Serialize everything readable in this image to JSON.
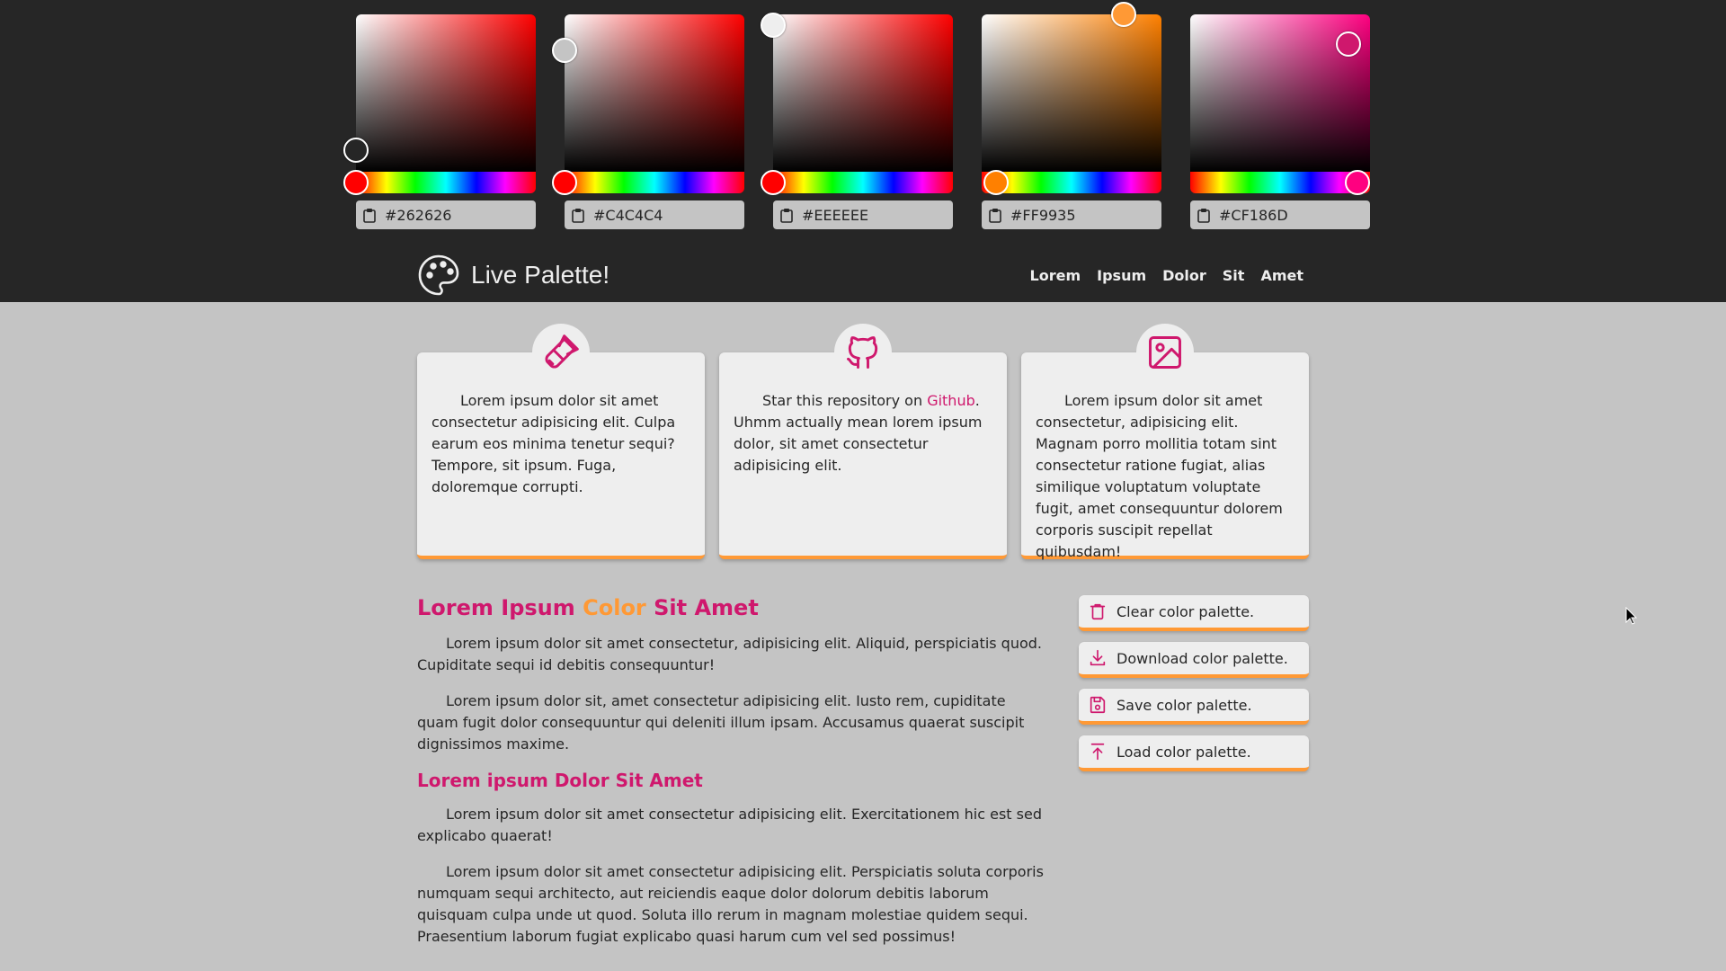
{
  "colors": {
    "dark": "#262626",
    "mid": "#c4c4c4",
    "light": "#eeeeee",
    "orange": "#ff9935",
    "pink": "#cf186d"
  },
  "pickers": [
    {
      "hex": "#262626",
      "hue_color": "#ff0000",
      "sv": [
        0.0,
        0.86
      ],
      "hue": 0.0
    },
    {
      "hex": "#C4C4C4",
      "hue_color": "#ff0000",
      "sv": [
        0.0,
        0.23
      ],
      "hue": 0.0
    },
    {
      "hex": "#EEEEEE",
      "hue_color": "#ff0000",
      "sv": [
        0.0,
        0.07
      ],
      "hue": 0.0
    },
    {
      "hex": "#FF9935",
      "hue_color": "#ff8000",
      "sv": [
        0.79,
        0.0
      ],
      "hue": 0.08
    },
    {
      "hex": "#CF186D",
      "hue_color": "#ff0080",
      "sv": [
        0.88,
        0.19
      ],
      "hue": 0.93
    }
  ],
  "header": {
    "title": "Live Palette!",
    "logo_icon": "palette-icon",
    "nav": [
      "Lorem",
      "Ipsum",
      "Dolor",
      "Sit",
      "Amet"
    ]
  },
  "cards": [
    {
      "icon": "paintbrush-icon",
      "text": "Lorem ipsum dolor sit amet consectetur adipisicing elit. Culpa earum eos minima tenetur sequi? Tempore, sit ipsum. Fuga, doloremque corrupti."
    },
    {
      "icon": "github-icon",
      "text_before": "Star this repository on ",
      "link": "Github",
      "text_after": ". Uhmm actually mean lorem ipsum dolor, sit amet consectetur adipisicing elit."
    },
    {
      "icon": "image-icon",
      "text": "Lorem ipsum dolor sit amet consectetur, adipisicing elit. Magnam porro mollitia totam sint consectetur ratione fugiat, alias similique voluptatum voluptate fugit, amet consequuntur dolorem corporis suscipit repellat quibusdam!"
    }
  ],
  "content": {
    "heading_part1": "Lorem Ipsum ",
    "heading_accent": "Color",
    "heading_part2": " Sit Amet",
    "paragraphs1": [
      "Lorem ipsum dolor sit amet consectetur, adipisicing elit. Aliquid, perspiciatis quod. Cupiditate sequi id debitis consequuntur!",
      "Lorem ipsum dolor sit, amet consectetur adipisicing elit. Iusto rem, cupiditate quam fugit dolor consequuntur qui deleniti illum ipsam. Accusamus quaerat suscipit dignissimos maxime."
    ],
    "subheading": "Lorem ipsum Dolor Sit Amet",
    "paragraphs2": [
      "Lorem ipsum dolor sit amet consectetur adipisicing elit. Exercitationem hic est sed explicabo quaerat!",
      "Lorem ipsum dolor sit amet consectetur adipisicing elit. Perspiciatis soluta corporis numquam sequi architecto, aut reiciendis eaque dolor dolorum debitis laborum quisquam culpa unde ut quod. Soluta illo rerum in magnam molestiae quidem sequi. Praesentium laborum fugiat explicabo quasi harum cum vel sed possimus!"
    ]
  },
  "actions": [
    {
      "label": "Clear color palette.",
      "icon": "trash-icon"
    },
    {
      "label": "Download color palette.",
      "icon": "download-icon"
    },
    {
      "label": "Save color palette.",
      "icon": "save-icon"
    },
    {
      "label": "Load color palette.",
      "icon": "upload-icon"
    }
  ]
}
